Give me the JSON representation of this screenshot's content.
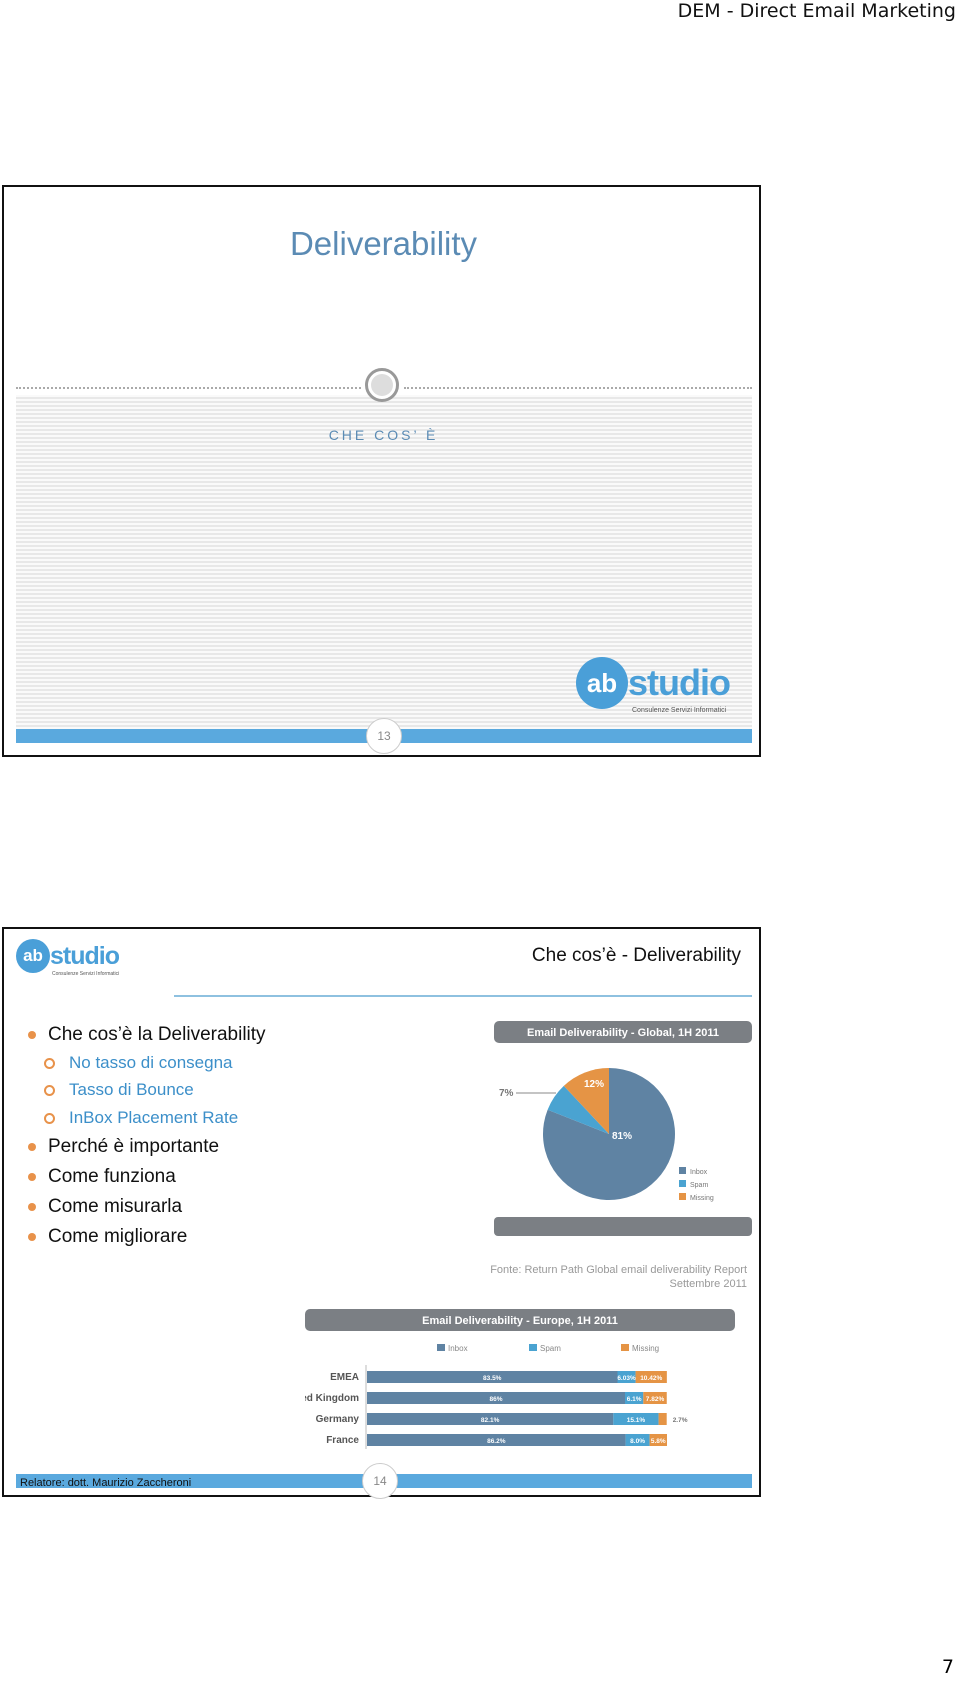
{
  "header": {
    "title": "DEM - Direct Email Marketing"
  },
  "page_number": "7",
  "slide1": {
    "title": "Deliverability",
    "subtitle": "CHE COS’ È",
    "number": "13",
    "logo": {
      "text": "abstudio",
      "tagline": "Consulenze Servizi Informatici"
    }
  },
  "slide2": {
    "title": "Che cos’è - Deliverability",
    "number": "14",
    "logo": {
      "text": "abstudio",
      "tagline": "Consulenze Servizi Informatici"
    },
    "bullets": [
      {
        "label": "Che cos’è la Deliverability",
        "sub": [
          "No tasso di consegna",
          "Tasso di Bounce",
          "InBox Placement Rate"
        ]
      },
      {
        "label": "Perché è importante"
      },
      {
        "label": "Come funziona"
      },
      {
        "label": "Come misurarla"
      },
      {
        "label": "Come migliorare"
      }
    ],
    "source": [
      "Fonte: Return Path Global email deliverability Report",
      "Settembre 2011"
    ],
    "footer": "Relatore: dott. Maurizio Zaccheroni"
  },
  "chart_data": [
    {
      "type": "pie",
      "title": "Email Deliverability - Global, 1H 2011",
      "slices": [
        {
          "label": "Inbox",
          "value": 81,
          "display": "81%"
        },
        {
          "label": "Spam",
          "value": 7,
          "display": "7%"
        },
        {
          "label": "Missing",
          "value": 12,
          "display": "12%"
        }
      ],
      "legend": "bottom-right",
      "colors": {
        "Inbox": "#5f83a3",
        "Spam": "#4aa3d1",
        "Missing": "#e59445"
      }
    },
    {
      "type": "bar",
      "stacked": true,
      "orientation": "horizontal",
      "title": "Email Deliverability - Europe,  1H 2011",
      "categories": [
        "EMEA",
        "United Kingdom",
        "Germany",
        "France"
      ],
      "series": [
        {
          "name": "Inbox",
          "values": [
            83.5,
            86,
            82.1,
            86.2
          ],
          "labels": [
            "83.5%",
            "86%",
            "82.1%",
            "86.2%"
          ]
        },
        {
          "name": "Spam",
          "values": [
            6.03,
            6.1,
            15.1,
            8.0
          ],
          "labels": [
            "6.03%",
            "6.1%",
            "15.1%",
            "8.0%"
          ]
        },
        {
          "name": "Missing",
          "values": [
            10.42,
            7.82,
            2.7,
            5.8
          ],
          "labels": [
            "10.42%",
            "7.82%",
            "2.7%",
            "5.8%"
          ]
        }
      ],
      "legend": "top",
      "colors": {
        "Inbox": "#5f83a3",
        "Spam": "#4aa3d1",
        "Missing": "#e59445"
      }
    }
  ]
}
